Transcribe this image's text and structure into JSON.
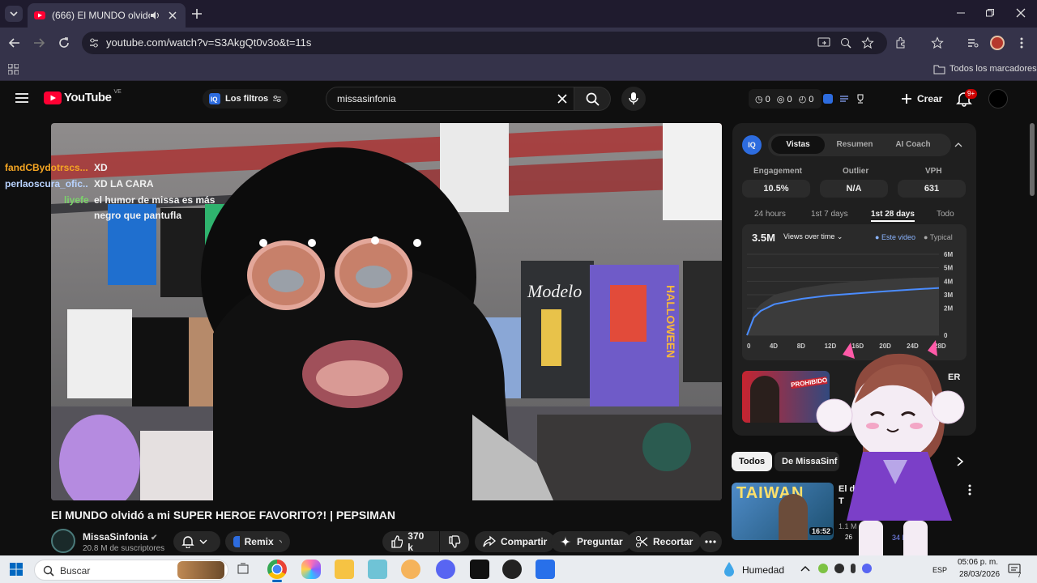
{
  "browser": {
    "tab_title": "(666) El MUNDO olvidó a mi",
    "url": "youtube.com/watch?v=S3AkgQt0v3o&t=11s",
    "bookmarks_label": "Todos los marcadores"
  },
  "youtube": {
    "logo_text": "YouTube",
    "region": "VE",
    "filters_label": "Los filtros",
    "search_value": "missasinfonia",
    "counters": [
      "0",
      "0",
      "0"
    ],
    "create_label": "Crear",
    "notif_badge": "9+"
  },
  "chat": [
    {
      "user": "fandCBydotrscs...",
      "msg": "XD",
      "color": "#f5a623"
    },
    {
      "user": "perlaoscura_ofic...",
      "msg": "XD LA CARA",
      "color": "#b9d3ff"
    },
    {
      "user": "liyefe",
      "msg": "el humor de missa es más",
      "color": "#7bd36a"
    },
    {
      "user": "",
      "msg": "negro que pantufla",
      "color": "#ffffff"
    }
  ],
  "video": {
    "title": "El MUNDO olvidó a mi SUPER HEROE FAVORITO?! | PEPSIMAN",
    "channel": "MissaSinfonia",
    "subscribers": "20.8 M de suscriptores",
    "remix_label": "Remix",
    "likes": "370 k",
    "share_label": "Compartir",
    "ask_label": "Preguntar",
    "clip_label": "Recortar",
    "shirt_text_1": "Modelo",
    "shirt_text_2": "HALLOWEEN"
  },
  "vidiq": {
    "tabs": [
      "Vistas",
      "Resumen",
      "AI Coach"
    ],
    "metrics": [
      {
        "label": "Engagement",
        "value": "10.5%"
      },
      {
        "label": "Outlier",
        "value": "N/A"
      },
      {
        "label": "VPH",
        "value": "631"
      }
    ],
    "ranges": [
      "24 hours",
      "1st 7 days",
      "1st 28 days",
      "Todo"
    ],
    "total_views": "3.5M",
    "views_dropdown": "Views over time",
    "legend_this": "Este video",
    "legend_typical": "Typical",
    "rec_title": "ER",
    "rec_thumb_text": "PROHIBIDO"
  },
  "chart_data": {
    "type": "area",
    "x_ticks": [
      "0",
      "4D",
      "8D",
      "12D",
      "16D",
      "20D",
      "24D",
      "28D"
    ],
    "y_ticks": [
      "0",
      "2M",
      "3M",
      "4M",
      "5M",
      "6M"
    ],
    "ylim": [
      0,
      6000000
    ],
    "series": [
      {
        "name": "Este video",
        "x": [
          0,
          1,
          2,
          4,
          8,
          12,
          16,
          20,
          24,
          28
        ],
        "values": [
          0,
          1300000,
          1800000,
          2300000,
          2700000,
          2950000,
          3100000,
          3250000,
          3380000,
          3500000
        ]
      },
      {
        "name": "Typical",
        "x": [
          0,
          1,
          2,
          4,
          8,
          12,
          16,
          20,
          24,
          28
        ],
        "values": [
          0,
          1700000,
          2300000,
          3000000,
          3500000,
          3800000,
          4000000,
          4150000,
          4250000,
          4300000
        ]
      }
    ]
  },
  "chips": [
    "Todos",
    "De MissaSinf"
  ],
  "next_video": {
    "title_1": "El d",
    "title_2": "T",
    "duration": "16:52",
    "thumb_text": "TAIWAN",
    "meta_1": "1.1 M",
    "meta_2": "26",
    "meta_3": "34 M"
  },
  "taskbar": {
    "search_label": "Buscar",
    "weather": "Humedad",
    "lang": "ESP",
    "time": "05:06 p. m.",
    "date": "28/03/2026",
    "notif_count": "7"
  }
}
